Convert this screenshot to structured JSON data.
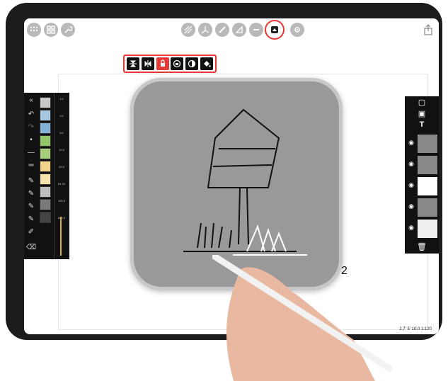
{
  "toolbar_left": [
    {
      "name": "brush-library-icon",
      "glyph": "⠿"
    },
    {
      "name": "grid-icon",
      "glyph": "▦"
    },
    {
      "name": "wrench-icon",
      "glyph": "🔧"
    }
  ],
  "toolbar_center": [
    {
      "name": "hatch-tool-icon",
      "glyph": "▨"
    },
    {
      "name": "perspective-tool-icon",
      "glyph": "⟂"
    },
    {
      "name": "pen-tool-icon",
      "glyph": "/"
    },
    {
      "name": "triangle-tool-icon",
      "glyph": "◿"
    },
    {
      "name": "minus-tool-icon",
      "glyph": "⊖"
    },
    {
      "name": "symmetry-tool-icon",
      "glyph": "⧉"
    },
    {
      "name": "settings-gear-icon",
      "glyph": "⚙"
    }
  ],
  "subtools": [
    {
      "name": "flip-vertical-icon",
      "glyph": "⏚"
    },
    {
      "name": "flip-horizontal-icon",
      "glyph": "⧓"
    },
    {
      "name": "lock-icon",
      "glyph": "🔒"
    },
    {
      "name": "rotate-lock-icon",
      "glyph": "⟳"
    },
    {
      "name": "contrast-icon",
      "glyph": "◐"
    },
    {
      "name": "fill-bucket-icon",
      "glyph": "◭"
    }
  ],
  "colors": {
    "swatches": [
      "#c8c8c8",
      "#a8c7e0",
      "#86b1d6",
      "#95c56b",
      "#a9cf7d",
      "#f0d48a",
      "#f6e3b0",
      "#bebebe",
      "#7a7a7a",
      "#454545"
    ],
    "accent": "#e53935",
    "panel": "#111111"
  },
  "brush_sizes": [
    "1.0",
    "2.0",
    "5.0",
    "10.0",
    "20.0",
    "51.20",
    "100.0",
    "500.0"
  ],
  "right_panel": {
    "items": [
      "page-icon",
      "image-icon",
      "T"
    ],
    "text_label": "T",
    "layers": [
      "layer-1",
      "layer-2",
      "layer-3",
      "layer-4",
      "layer-5"
    ]
  },
  "status": {
    "scale": "1:120",
    "value_a": "2.7'",
    "value_b": "10.0",
    "value_c": "5'"
  },
  "page_number": "2"
}
